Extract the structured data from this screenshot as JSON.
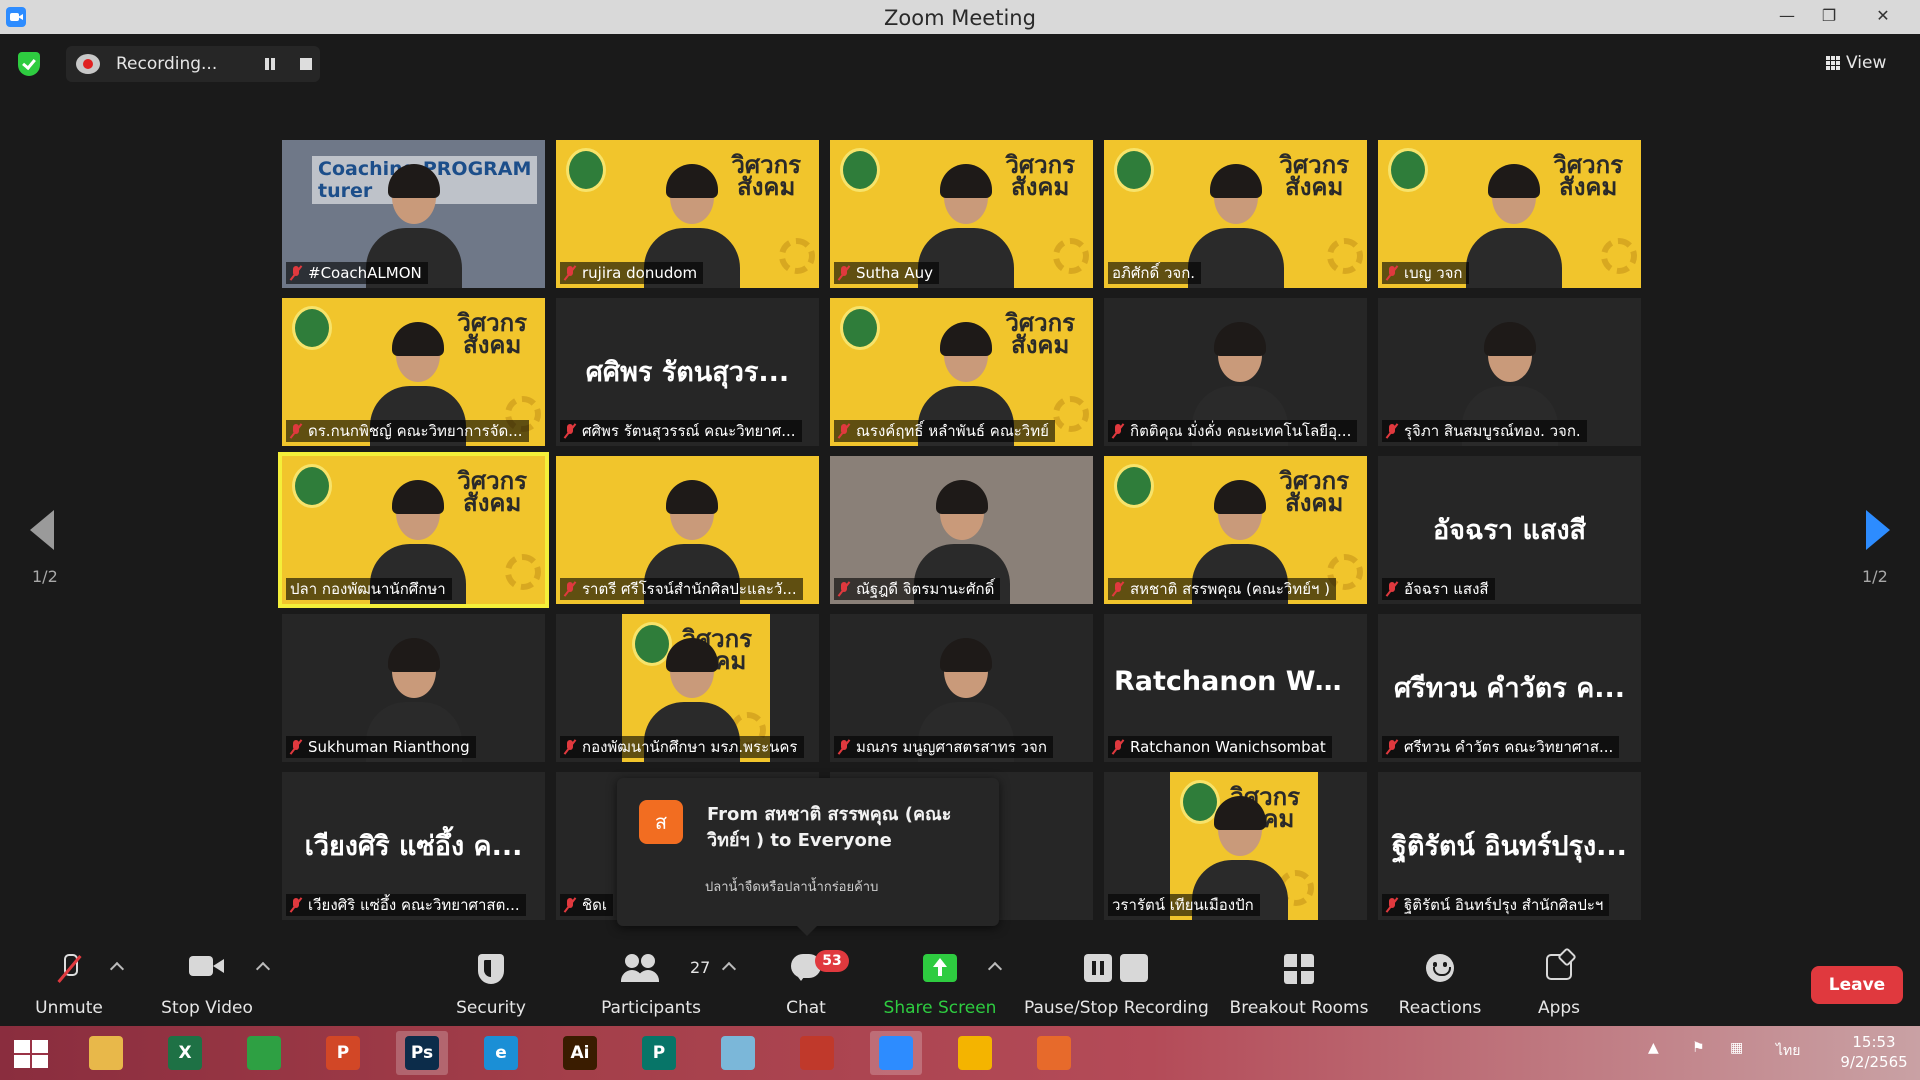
{
  "window": {
    "title": "Zoom Meeting"
  },
  "recording": {
    "status": "Recording..."
  },
  "view": {
    "label": "View"
  },
  "pagination": {
    "left": "1/2",
    "right": "1/2"
  },
  "tiles": [
    {
      "name": "#CoachALMON",
      "muted": true,
      "bg": "photo",
      "overlay": "Coaching PROGRAM\nturer"
    },
    {
      "name": "rujira donudom",
      "muted": true,
      "bg": "yellow",
      "brand": "วิศวกร\nสังคม"
    },
    {
      "name": "Sutha Auy",
      "muted": true,
      "bg": "yellow",
      "brand": "วิศวกร\nสังคม"
    },
    {
      "name": "อภิศักดิ์ วจก.",
      "muted": false,
      "bg": "yellow",
      "brand": "วิศวกร\nสังคม"
    },
    {
      "name": "เบญ วจก",
      "muted": true,
      "bg": "yellow",
      "brand": "วิศวกร\nสังคม"
    },
    {
      "name": "ดร.กนกพิชญ์ คณะวิทยาการจัด...",
      "muted": true,
      "bg": "yellow",
      "brand": "วิศวกร\nสังคม"
    },
    {
      "name": "ศศิพร รัตนสุวรรณ์ คณะวิทยาศ...",
      "muted": true,
      "bg": "dark",
      "big": "ศศิพร รัตนสุวร..."
    },
    {
      "name": "ณรงค์ฤทธิ์ หลำพันธ์ คณะวิทย์",
      "muted": true,
      "bg": "yellow",
      "brand": "วิศวกร\nสังคม"
    },
    {
      "name": "กิตติคุณ มั่งคั่ง คณะเทคโนโลยีอุ...",
      "muted": true,
      "bg": "dark"
    },
    {
      "name": "รุจิภา สินสมบูรณ์ทอง. วจก.",
      "muted": true,
      "bg": "dark"
    },
    {
      "name": "ปลา กองพัฒนานักศึกษา",
      "muted": false,
      "bg": "yellow",
      "active": true,
      "brand": "วิศวกร\nสังคม"
    },
    {
      "name": "ราตรี ศรีโรจน์สำนักศิลปะและวั...",
      "muted": true,
      "bg": "yellow"
    },
    {
      "name": "ณัฐฎดี จิตรมานะศักดิ์",
      "muted": true,
      "bg": "office"
    },
    {
      "name": "สหชาติ สรรพคุณ (คณะวิทย์ฯ )",
      "muted": true,
      "bg": "yellow",
      "brand": "วิศวกร\nสังคม"
    },
    {
      "name": "อัจฉรา แสงสี",
      "muted": true,
      "bg": "dark",
      "big": "อัจฉรา แสงสี"
    },
    {
      "name": "Sukhuman Rianthong",
      "muted": true,
      "bg": "dark"
    },
    {
      "name": "กองพัฒนานักศึกษา มรภ.พระนคร",
      "muted": true,
      "bg": "dark",
      "brand": "วิศวกร\nสังคม"
    },
    {
      "name": "มณภร มนูญศาสตรสาทร วจก",
      "muted": true,
      "bg": "dark"
    },
    {
      "name": "Ratchanon Wanichsombat",
      "muted": true,
      "bg": "dark",
      "big": "Ratchanon Wan..."
    },
    {
      "name": "ศรีทวน คำวัตร คณะวิทยาศาส...",
      "muted": true,
      "bg": "dark",
      "big": "ศรีทวน คำวัตร ค..."
    },
    {
      "name": "เวียงศิริ แซ่อึ้ง คณะวิทยาศาสต...",
      "muted": true,
      "bg": "dark",
      "big": "เวียงศิริ แซ่อึ้ง ค..."
    },
    {
      "name": "ชิดเ",
      "muted": true,
      "bg": "dark",
      "big": "ชิดเ"
    },
    {
      "name": "",
      "muted": false,
      "bg": "dark"
    },
    {
      "name": "วรารัตน์ เทียนเมืองปัก",
      "muted": false,
      "bg": "dark",
      "brand": "วิศวกร\nสังคม"
    },
    {
      "name": "ฐิติรัตน์ อินทร์ปรุง สำนักศิลปะฯ",
      "muted": true,
      "bg": "dark",
      "big": "ฐิติรัตน์ อินทร์ปรุง..."
    }
  ],
  "chat_popup": {
    "avatar_letter": "ส",
    "from": "From สหชาติ สรรพคุณ (คณะวิทย์ฯ ) to Everyone",
    "message": "ปลาน้ำจืดหรือปลาน้ำกร่อยค้าบ"
  },
  "toolbar": {
    "unmute": "Unmute",
    "stop_video": "Stop Video",
    "security": "Security",
    "participants": "Participants",
    "participants_count": "27",
    "chat": "Chat",
    "chat_badge": "53",
    "share_screen": "Share Screen",
    "pause_stop_recording": "Pause/Stop Recording",
    "breakout_rooms": "Breakout Rooms",
    "reactions": "Reactions",
    "apps": "Apps",
    "leave": "Leave"
  },
  "taskbar": {
    "apps": [
      {
        "name": "file-explorer-icon",
        "label": "",
        "color": "#e8b84a"
      },
      {
        "name": "excel-icon",
        "label": "X",
        "color": "#1e7145"
      },
      {
        "name": "store-icon",
        "label": "",
        "color": "#2ea043"
      },
      {
        "name": "powerpoint-icon",
        "label": "P",
        "color": "#d24726"
      },
      {
        "name": "photoshop-icon",
        "label": "Ps",
        "color": "#0c2c4a"
      },
      {
        "name": "internet-explorer-icon",
        "label": "e",
        "color": "#1b8fd6"
      },
      {
        "name": "illustrator-icon",
        "label": "Ai",
        "color": "#3a1c00"
      },
      {
        "name": "publisher-icon",
        "label": "P",
        "color": "#077568"
      },
      {
        "name": "notes-icon",
        "label": "",
        "color": "#7bb7d9"
      },
      {
        "name": "photoscape-icon",
        "label": "",
        "color": "#c0392b"
      },
      {
        "name": "zoom-icon",
        "label": "",
        "color": "#2d8cff"
      },
      {
        "name": "chrome-icon",
        "label": "",
        "color": "#f4b400"
      },
      {
        "name": "photos-icon",
        "label": "",
        "color": "#e76a2b"
      }
    ],
    "language": "ไทย",
    "time": "15:53",
    "date": "9/2/2565"
  }
}
